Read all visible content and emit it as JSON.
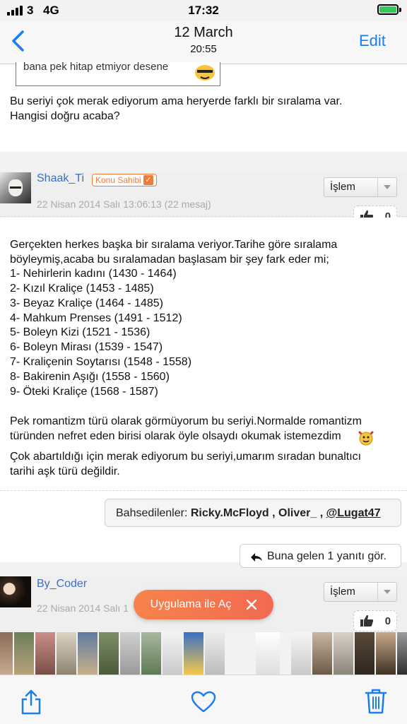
{
  "status_bar": {
    "carrier": "3",
    "network": "4G",
    "time": "17:32"
  },
  "nav": {
    "title": "12 March",
    "subtitle": "20:55",
    "edit_label": "Edit"
  },
  "quote": {
    "text": "bana pek hitap etmiyor desene"
  },
  "post1": {
    "lines": [
      "Bu seriyi çok merak ediyorum ama heryerde farklı bir sıralama var.",
      "Hangisi doğru acaba?"
    ]
  },
  "post2": {
    "username": "Shaak_Ti",
    "badge": "Konu Sahibi",
    "meta": "22 Nisan 2014 Salı 13:06:13 (22 mesaj)",
    "action_select": "İşlem",
    "likes": "0",
    "intro_lines": [
      "Gerçekten herkes başka bir sıralama veriyor.Tarihe göre sıralama",
      "böyleymiş,acaba bu sıralamadan başlasam bir şey fark eder mi;"
    ],
    "list": [
      "1- Nehirlerin kadını (1430 - 1464)",
      "2- Kızıl Kraliçe (1453 - 1485)",
      "3- Beyaz Kraliçe (1464 - 1485)",
      "4- Mahkum Prenses (1491 - 1512)",
      "5- Boleyn Kizi (1521 - 1536)",
      "6- Boleyn Mirası (1539 - 1547)",
      "7- Kraliçenin Soytarısı (1548 - 1558)",
      "8- Bakirenin Aşığı (1558 - 1560)",
      "9- Öteki Kraliçe (1568 - 1587)"
    ],
    "para1_lines": [
      "Pek romantizm türü olarak görmüyorum bu seriyi.Normalde romantizm",
      "türünden nefret eden birisi olarak öyle olsaydı okumak istemezdim"
    ],
    "para2_lines": [
      "Çok abartıldığı için merak ediyorum bu seriyi,umarım sıradan bunaltıcı",
      "tarihi aşk türü değildir."
    ],
    "mentions": {
      "label": "Bahsedilenler:",
      "names": "Ricky.McFloyd , Oliver_ ,",
      "link": "@Lugat47"
    },
    "reply_button": "Buna gelen 1 yanıtı gör."
  },
  "post3": {
    "username": "By_Coder",
    "meta": "22 Nisan 2014 Salı 1",
    "action_select": "İşlem",
    "likes": "0"
  },
  "banner": {
    "label": "Uygulama ile Aç"
  },
  "colors": {
    "accent": "#1a7df0",
    "username": "#3a6fc4",
    "badge": "#f07a3a",
    "banner": "#f26a51"
  },
  "icons": [
    "back-chevron-icon",
    "thumbs-up-icon",
    "reply-arrow-icon",
    "close-icon",
    "share-icon",
    "heart-icon",
    "trash-icon"
  ]
}
